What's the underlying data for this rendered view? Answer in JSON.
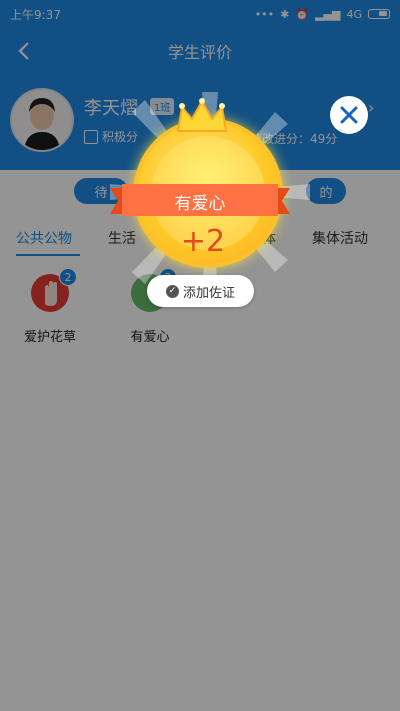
{
  "status_bar": {
    "time": "上午9:37",
    "signal_text": "4G",
    "dots": "•••"
  },
  "nav": {
    "title": "学生评价"
  },
  "profile": {
    "name": "李天熠",
    "class_badge": "1班",
    "points_label": "积极分",
    "progress_label": "待改进分：49分"
  },
  "eval_buttons": {
    "left": "待",
    "right": "的"
  },
  "tabs": [
    {
      "label": "公共公物"
    },
    {
      "label": "生活"
    },
    {
      "label": "体"
    },
    {
      "label": "集体活动"
    }
  ],
  "items": [
    {
      "label": "爱护花草",
      "badge": "2",
      "icon": "raised-hand-icon"
    },
    {
      "label": "有爱心",
      "badge": "2",
      "icon": "heart-person-icon"
    }
  ],
  "popup": {
    "ribbon_label": "有爱心",
    "points": "+2",
    "evidence_button": "添加佐证"
  },
  "colors": {
    "primary": "#1e88e5",
    "coin_gold": "#ffca28",
    "ribbon_orange": "#ff7043",
    "points_red": "#e64a19"
  }
}
